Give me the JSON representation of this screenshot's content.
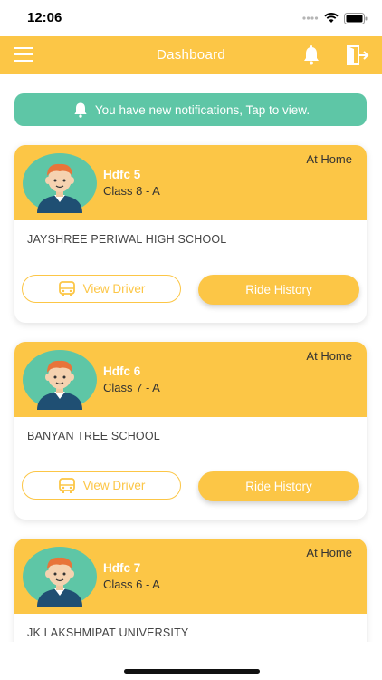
{
  "status_bar": {
    "time": "12:06"
  },
  "header": {
    "title": "Dashboard"
  },
  "notification": {
    "text": "You have new notifications, Tap to view."
  },
  "students": [
    {
      "name": "Hdfc 5",
      "class": "Class 8 - A",
      "status": "At Home",
      "school": "JAYSHREE PERIWAL HIGH SCHOOL",
      "view_driver_label": "View Driver",
      "ride_history_label": "Ride History"
    },
    {
      "name": "Hdfc 6",
      "class": "Class 7 - A",
      "status": "At Home",
      "school": "BANYAN TREE SCHOOL",
      "view_driver_label": "View Driver",
      "ride_history_label": "Ride History"
    },
    {
      "name": "Hdfc 7",
      "class": "Class 6 - A",
      "status": "At Home",
      "school": "JK LAKSHMIPAT UNIVERSITY"
    }
  ],
  "colors": {
    "accent": "#fcc646",
    "notification": "#5ec6a6",
    "avatar_bg": "#5ec6a6"
  },
  "icons": [
    "menu-icon",
    "bell-icon",
    "logout-icon",
    "bus-icon",
    "avatar-boy-icon"
  ]
}
